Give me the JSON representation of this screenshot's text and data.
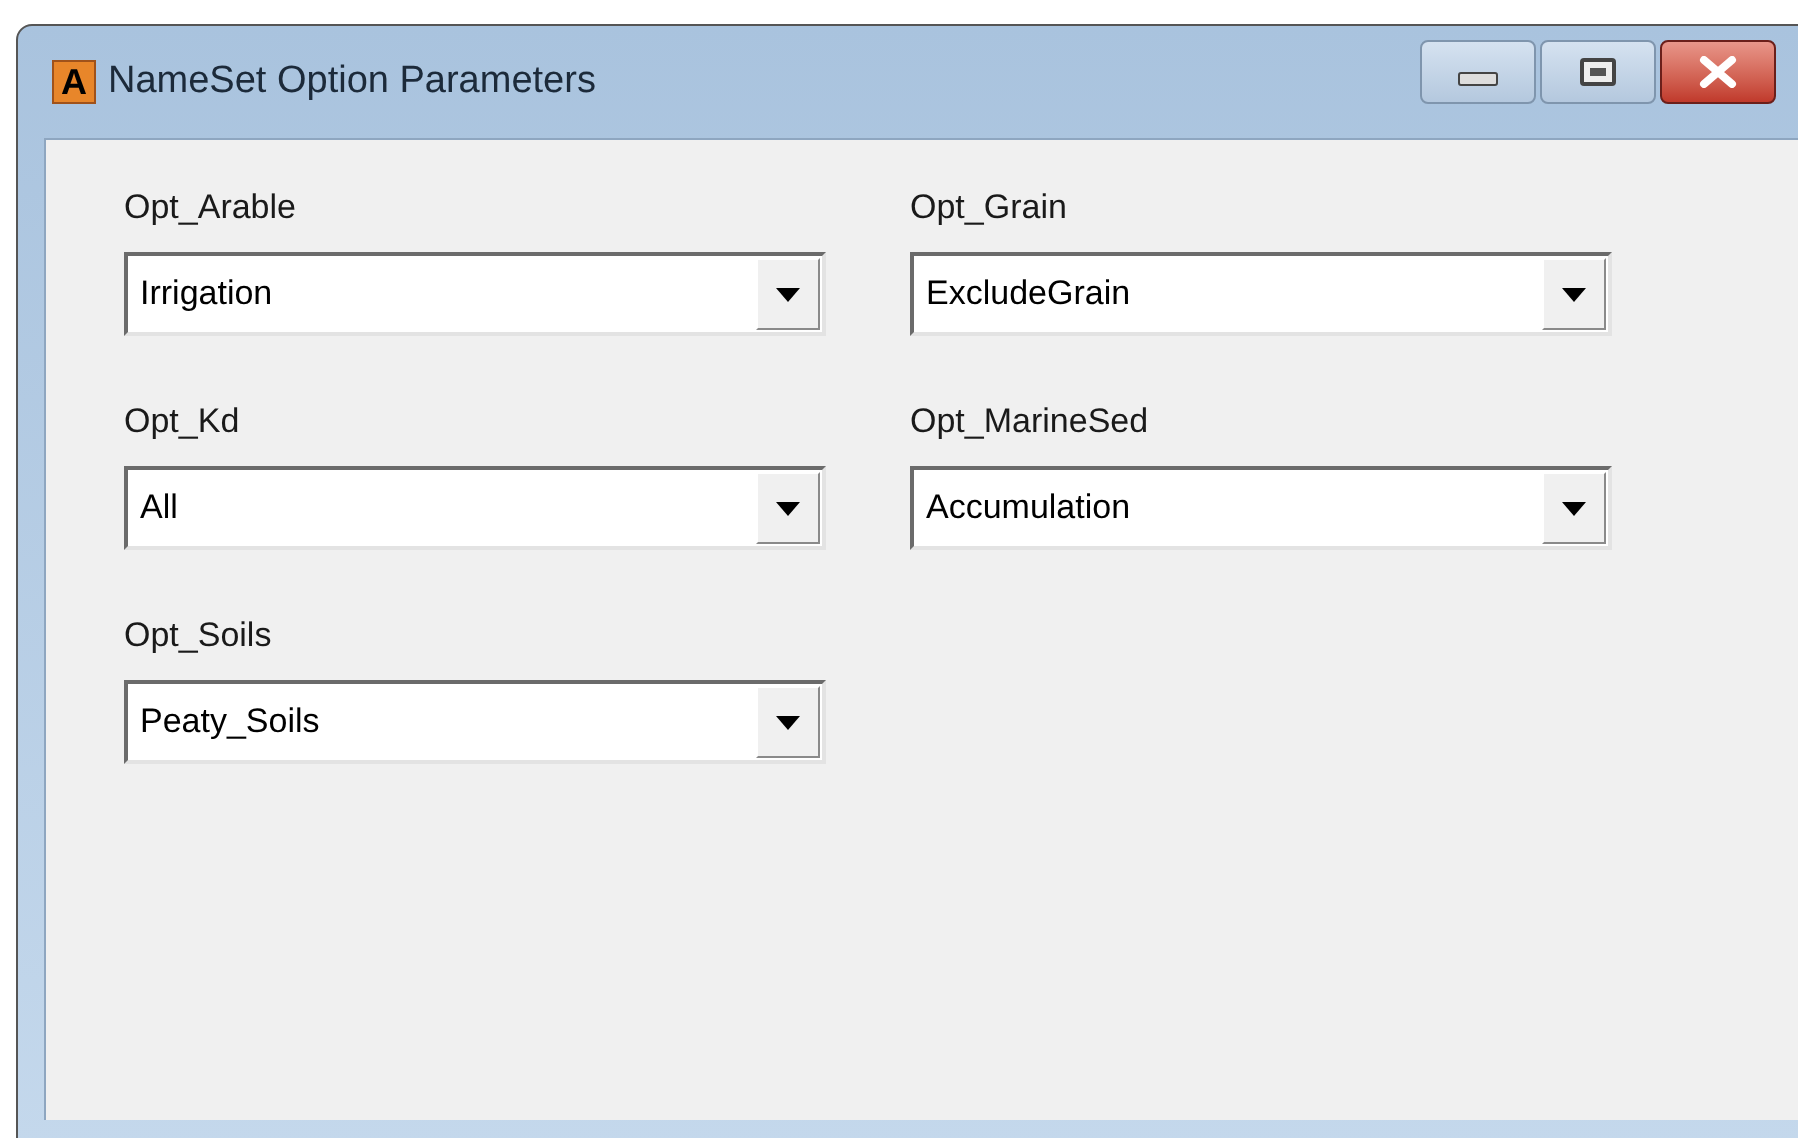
{
  "window": {
    "title": "NameSet Option Parameters",
    "app_icon_letter": "A"
  },
  "options": [
    {
      "label": "Opt_Arable",
      "value": "Irrigation"
    },
    {
      "label": "Opt_Grain",
      "value": "ExcludeGrain"
    },
    {
      "label": "Opt_Kd",
      "value": "All"
    },
    {
      "label": "Opt_MarineSed",
      "value": "Accumulation"
    },
    {
      "label": "Opt_Soils",
      "value": "Peaty_Soils"
    }
  ]
}
